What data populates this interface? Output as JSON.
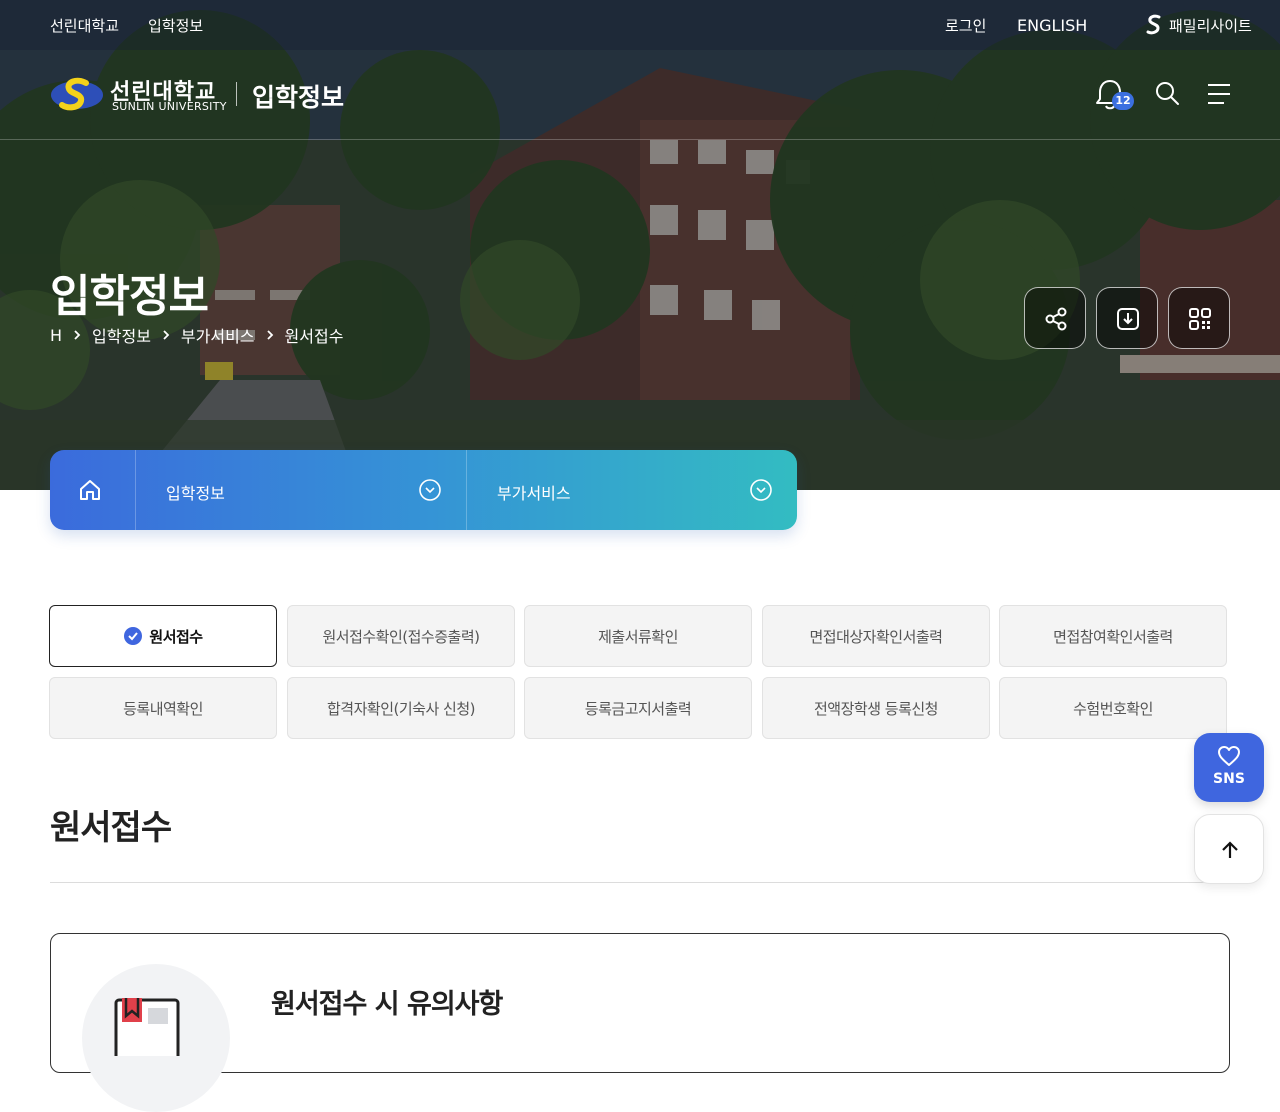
{
  "utility": {
    "university_link": "선린대학교",
    "admission_link": "입학정보",
    "login": "로그인",
    "english": "ENGLISH",
    "family_site": "패밀리사이트"
  },
  "header": {
    "logo_ko": "선린대학교",
    "logo_en": "SUNLIN UNIVERSITY",
    "section_title": "입학정보",
    "notification_count": "12",
    "icons": [
      "bell-icon",
      "search-icon",
      "menu-icon"
    ]
  },
  "hero": {
    "page_title": "입학정보",
    "breadcrumb": [
      "H",
      "입학정보",
      "부가서비스",
      "원서접수"
    ],
    "tool_icons": [
      "share-icon",
      "download-icon",
      "qr-code-icon"
    ]
  },
  "subnav": {
    "home_icon": "home-icon",
    "dropdown_1": "입학정보",
    "dropdown_2": "부가서비스"
  },
  "tabs": [
    "원서접수",
    "원서접수확인(접수증출력)",
    "제출서류확인",
    "면접대상자확인서출력",
    "면접참여확인서출력",
    "등록내역확인",
    "합격자확인(기숙사 신청)",
    "등록금고지서출력",
    "전액장학생 등록신청",
    "수험번호확인"
  ],
  "active_tab": "원서접수",
  "content": {
    "title": "원서접수",
    "notice_title": "원서접수 시 유의사항"
  },
  "floating": {
    "sns_label": "SNS"
  },
  "colors": {
    "accent_blue": "#3f66df",
    "subnav_start": "#3b6bdc",
    "subnav_end": "#33bcc2",
    "logo_yellow": "#f3d21a"
  }
}
